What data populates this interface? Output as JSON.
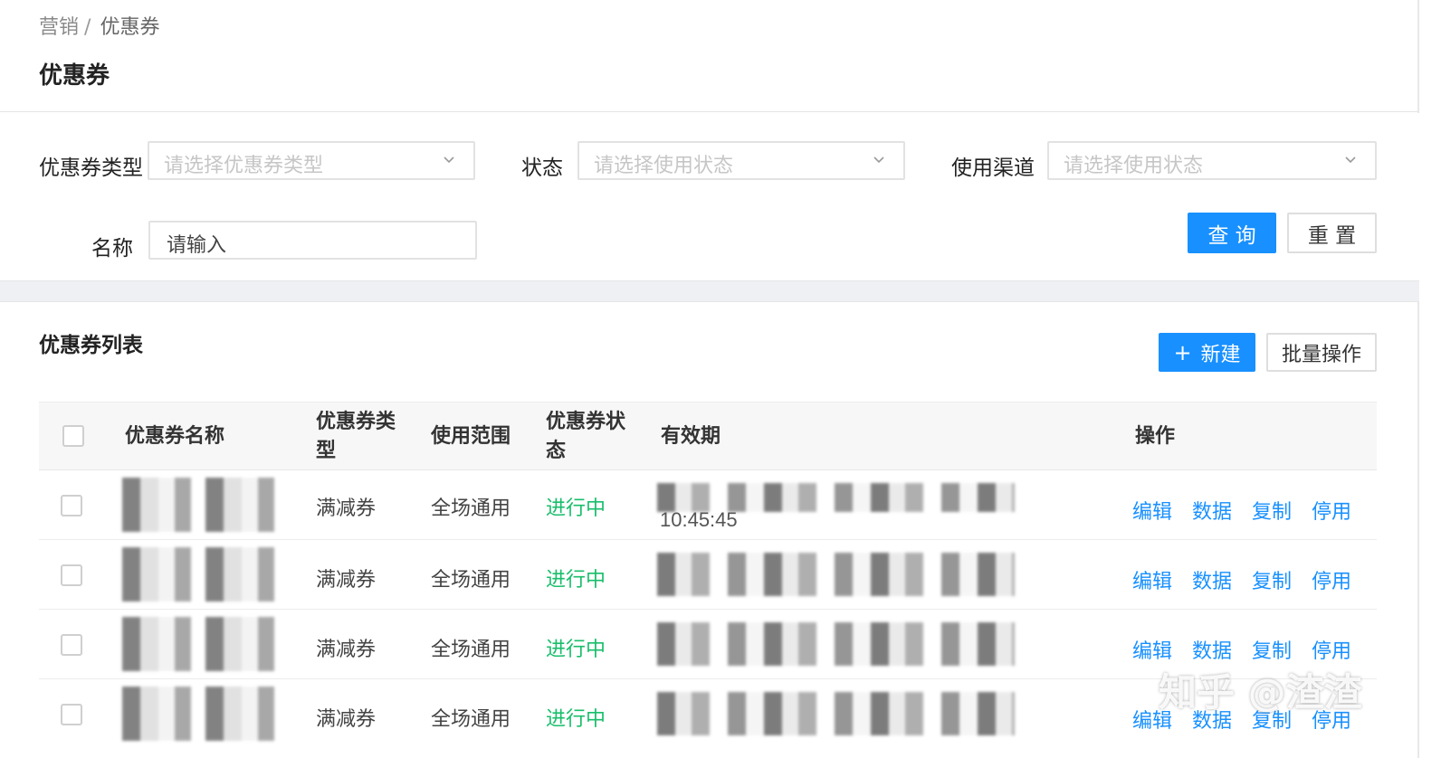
{
  "breadcrumb": {
    "parent": "营销",
    "separator": "/",
    "current": "优惠券"
  },
  "page_title": "优惠券",
  "filters": {
    "coupon_type": {
      "label": "优惠券类型",
      "placeholder": "请选择优惠券类型"
    },
    "status": {
      "label": "状态",
      "placeholder": "请选择使用状态"
    },
    "channel": {
      "label": "使用渠道",
      "placeholder": "请选择使用状态"
    },
    "name": {
      "label": "名称",
      "value": "请输入"
    },
    "query_label": "查 询",
    "reset_label": "重 置"
  },
  "list": {
    "title": "优惠券列表",
    "new_label": "新建",
    "new_icon": "plus-icon",
    "batch_label": "批量操作",
    "columns": {
      "name": "优惠券名称",
      "type": "优惠券类型",
      "scope": "使用范围",
      "status": "优惠券状态",
      "validity": "有效期",
      "actions": "操作"
    },
    "rows": [
      {
        "type": "满减券",
        "scope": "全场通用",
        "status": "进行中",
        "validity_time": "10:45:45"
      },
      {
        "type": "满减券",
        "scope": "全场通用",
        "status": "进行中",
        "validity_time": ""
      },
      {
        "type": "满减券",
        "scope": "全场通用",
        "status": "进行中",
        "validity_time": ""
      },
      {
        "type": "满减券",
        "scope": "全场通用",
        "status": "进行中",
        "validity_time": ""
      }
    ],
    "row_actions": {
      "edit": "编辑",
      "data": "数据",
      "copy": "复制",
      "disable": "停用"
    }
  },
  "watermark": "知乎 @渣渣",
  "colors": {
    "primary": "#1890ff",
    "status_active": "#19be6b"
  }
}
